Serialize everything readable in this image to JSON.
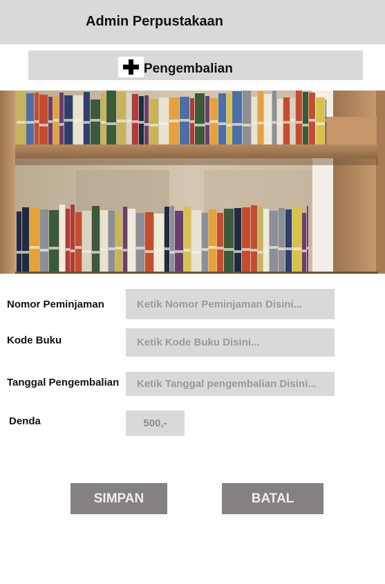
{
  "header": {
    "title": "Admin Perpustakaan"
  },
  "subheader": {
    "icon": "plus-icon",
    "label": "Pengembalian"
  },
  "hero": {
    "icon": "bookshelf-photo"
  },
  "form": {
    "nomor_peminjaman": {
      "label": "Nomor Peminjaman",
      "placeholder": "Ketik Nomor Peminjaman Disini..."
    },
    "kode_buku": {
      "label": "Kode Buku",
      "placeholder": "Ketik Kode Buku Disini..."
    },
    "tanggal_pengembalian": {
      "label": "Tanggal Pengembalian",
      "placeholder": "Ketik Tanggal pengembalian Disini..."
    },
    "denda": {
      "label": "Denda",
      "value": "500,-"
    }
  },
  "actions": {
    "save_label": "SIMPAN",
    "cancel_label": "BATAL"
  },
  "colors": {
    "bar": "#d9d9d9",
    "button": "#858181",
    "button_text": "#efefef"
  }
}
